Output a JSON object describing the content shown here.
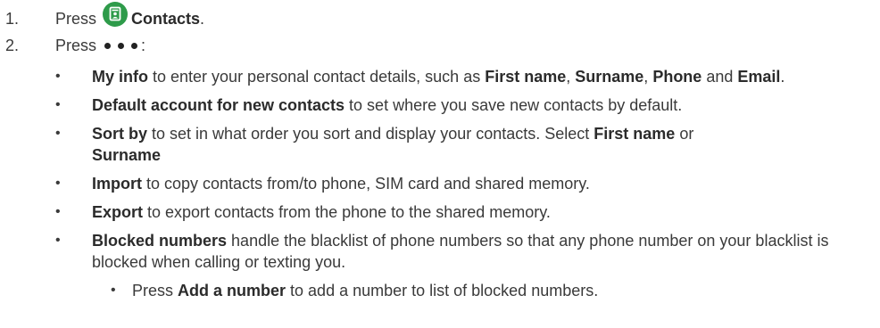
{
  "steps": [
    {
      "num": "1.",
      "pre": "Press",
      "bold": "Contacts",
      "post": "."
    },
    {
      "num": "2.",
      "pre": "Press",
      "post": ":"
    }
  ],
  "icons": {
    "contacts": "contacts-icon",
    "more": "more-options-icon"
  },
  "colors": {
    "contacts_icon_bg": "#2e9b4a"
  },
  "bullets": [
    {
      "b1": "My info",
      "t1": " to enter your personal contact details, such as ",
      "b2": "First name",
      "t2": ", ",
      "b3": "Surname",
      "t3": ", ",
      "b4": "Phone",
      "t4": " and ",
      "b5": "Email",
      "t5": "."
    },
    {
      "b1": "Default account for new contacts",
      "t1": " to set where you save new contacts by default."
    },
    {
      "b1": "Sort by",
      "t1": " to set in what order you sort and display your contacts. Select ",
      "b2": "First name",
      "t2": " or ",
      "b3": "Surname"
    },
    {
      "b1": "Import",
      "t1": " to copy contacts from/to phone, SIM card and shared memory."
    },
    {
      "b1": "Export",
      "t1": " to export contacts from the phone to the shared memory."
    },
    {
      "b1": "Blocked numbers",
      "t1": " handle the blacklist of phone numbers so that any phone number on your blacklist is blocked when calling or texting you."
    }
  ],
  "sub_bullets": [
    {
      "t0": "Press ",
      "b1": "Add a number",
      "t1": " to add a number to list of blocked numbers."
    }
  ],
  "bullet_glyph": "•"
}
